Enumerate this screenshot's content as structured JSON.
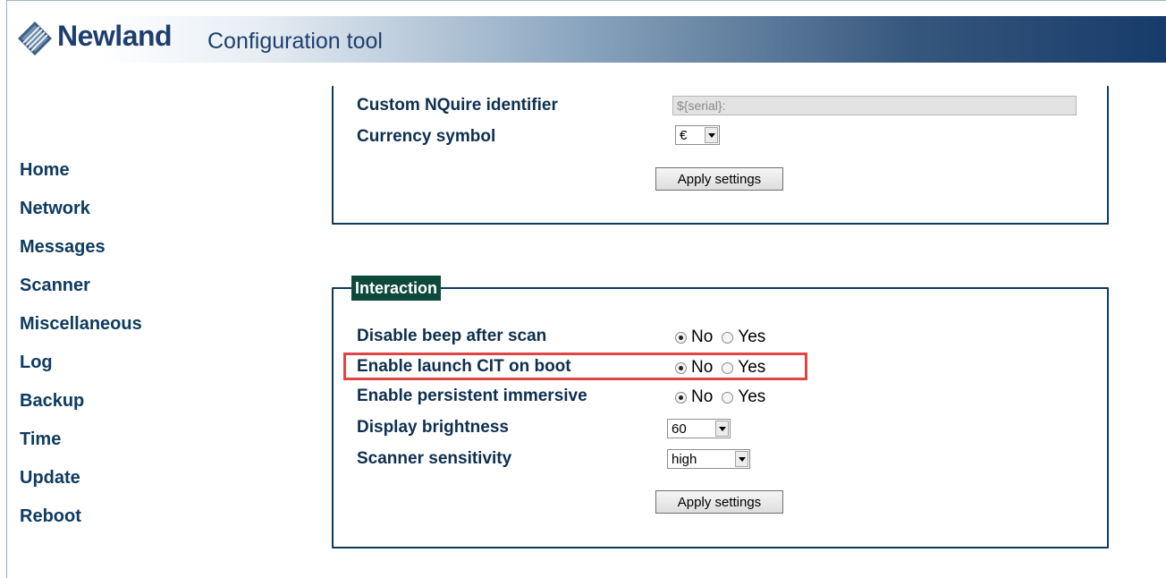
{
  "header": {
    "brand": "Newland",
    "subtitle": "Configuration tool"
  },
  "nav": {
    "items": [
      "Home",
      "Network",
      "Messages",
      "Scanner",
      "Miscellaneous",
      "Log",
      "Backup",
      "Time",
      "Update",
      "Reboot"
    ]
  },
  "general": {
    "identifier_label": "Custom NQuire identifier",
    "identifier_value": "${serial}:",
    "currency_label": "Currency symbol",
    "currency_value": "€",
    "apply_label": "Apply settings"
  },
  "interaction": {
    "legend": "Interaction",
    "rows": [
      {
        "label": "Disable beep after scan",
        "no": "No",
        "yes": "Yes",
        "selected": "No"
      },
      {
        "label": "Enable launch CIT on boot",
        "no": "No",
        "yes": "Yes",
        "selected": "No"
      },
      {
        "label": "Enable persistent immersive",
        "no": "No",
        "yes": "Yes",
        "selected": "No"
      }
    ],
    "brightness_label": "Display brightness",
    "brightness_value": "60",
    "sensitivity_label": "Scanner sensitivity",
    "sensitivity_value": "high",
    "apply_label": "Apply settings"
  },
  "colors": {
    "highlight": "#e04545",
    "legend_bg": "#0e4a3c",
    "panel_border": "#0e3b5c"
  }
}
